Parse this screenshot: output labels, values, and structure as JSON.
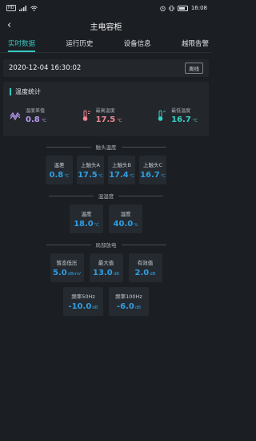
{
  "status_bar": {
    "left": "HD",
    "battery_text": "",
    "time": "16:08"
  },
  "header": {
    "back_glyph": "‹",
    "title": "主电容柜"
  },
  "tabs": [
    {
      "label": "实时数据",
      "active": true
    },
    {
      "label": "运行历史",
      "active": false
    },
    {
      "label": "设备信息",
      "active": false
    },
    {
      "label": "越限告警",
      "active": false
    }
  ],
  "datetime_bar": {
    "datetime": "2020-12-04 16:30:02",
    "status_badge": "离线"
  },
  "temperature_card": {
    "title": "温度统计",
    "stats": [
      {
        "label": "温度差值",
        "value": "0.8",
        "unit": "℃",
        "color": "#b99bf0",
        "icon": "wave-icon"
      },
      {
        "label": "最高温度",
        "value": "17.5",
        "unit": "℃",
        "color": "#f0878f",
        "icon": "thermometer-high-icon"
      },
      {
        "label": "最低温度",
        "value": "16.7",
        "unit": "℃",
        "color": "#35d0c6",
        "icon": "thermometer-low-icon"
      }
    ]
  },
  "contact_temp": {
    "heading": "触头温度",
    "items": [
      {
        "label": "温差",
        "value": "0.8",
        "unit": "℃"
      },
      {
        "label": "上触头A",
        "value": "17.5",
        "unit": "℃"
      },
      {
        "label": "上触头B",
        "value": "17.4",
        "unit": "℃"
      },
      {
        "label": "上触头C",
        "value": "16.7",
        "unit": "℃"
      }
    ]
  },
  "temp_humidity": {
    "heading": "温湿度",
    "items": [
      {
        "label": "温度",
        "value": "18.0",
        "unit": "℃"
      },
      {
        "label": "湿度",
        "value": "40.0",
        "unit": "%"
      }
    ]
  },
  "partial_discharge": {
    "heading": "局部放电",
    "row1": [
      {
        "label": "暂态低压",
        "value": "5.0",
        "unit": "dBmV"
      },
      {
        "label": "最大值",
        "value": "13.0",
        "unit": "dB"
      },
      {
        "label": "有效值",
        "value": "2.0",
        "unit": "dB"
      }
    ],
    "row2": [
      {
        "label": "频率50Hz",
        "value": "-10.0",
        "unit": "dB"
      },
      {
        "label": "频率100Hz",
        "value": "-6.0",
        "unit": "dB"
      }
    ]
  },
  "colors": {
    "accent": "#35c7c0",
    "value_blue": "#2f9ee0",
    "background": "#1b1e22",
    "card": "#23272c"
  }
}
